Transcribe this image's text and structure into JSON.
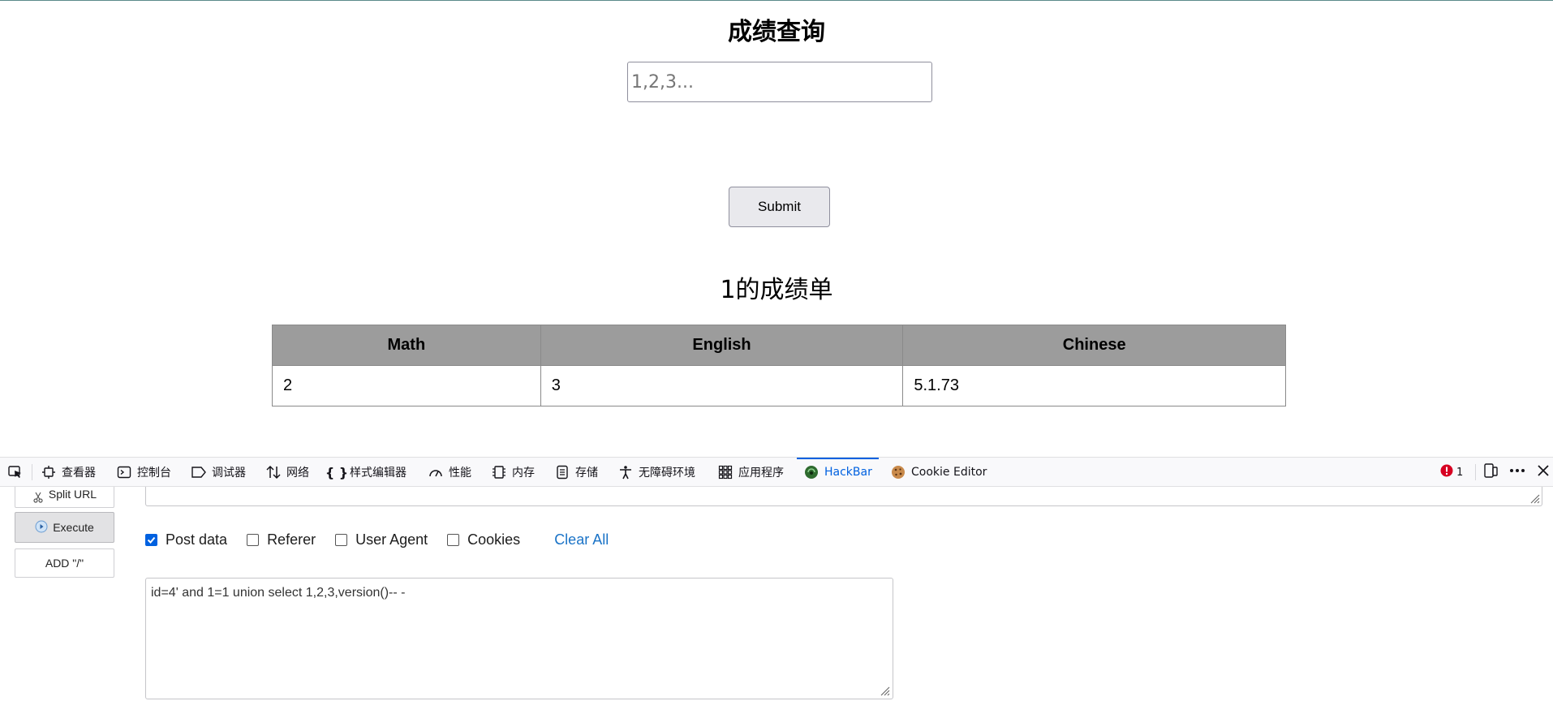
{
  "page": {
    "title": "成绩查询",
    "input_placeholder": "1,2,3...",
    "submit_label": "Submit",
    "result_title": "1的成绩单",
    "table": {
      "headers": [
        "Math",
        "English",
        "Chinese"
      ],
      "rows": [
        [
          "2",
          "3",
          "5.1.73"
        ]
      ]
    }
  },
  "devtools": {
    "tabs": [
      {
        "label": "查看器",
        "icon": "inspector-icon"
      },
      {
        "label": "控制台",
        "icon": "console-icon"
      },
      {
        "label": "调试器",
        "icon": "debugger-icon"
      },
      {
        "label": "网络",
        "icon": "network-icon"
      },
      {
        "label": "样式编辑器",
        "icon": "style-editor-icon"
      },
      {
        "label": "性能",
        "icon": "performance-icon"
      },
      {
        "label": "内存",
        "icon": "memory-icon"
      },
      {
        "label": "存储",
        "icon": "storage-icon"
      },
      {
        "label": "无障碍环境",
        "icon": "accessibility-icon"
      },
      {
        "label": "应用程序",
        "icon": "application-icon"
      },
      {
        "label": "HackBar",
        "icon": "hackbar-icon",
        "active": true
      },
      {
        "label": "Cookie Editor",
        "icon": "cookie-icon"
      }
    ],
    "error_count": "1",
    "accent_color": "#0061e0"
  },
  "hackbar": {
    "split_url_label": "Split URL",
    "execute_label": "Execute",
    "add_slash_label": "ADD \"/\"",
    "options": [
      {
        "label": "Post data",
        "checked": true
      },
      {
        "label": "Referer",
        "checked": false
      },
      {
        "label": "User Agent",
        "checked": false
      },
      {
        "label": "Cookies",
        "checked": false
      }
    ],
    "clear_all_label": "Clear All",
    "post_body": "id=4' and 1=1 union select 1,2,3,version()-- -"
  }
}
